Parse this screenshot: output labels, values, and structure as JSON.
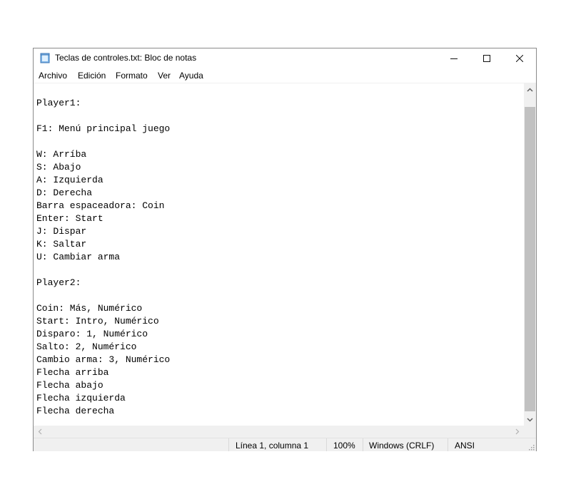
{
  "window": {
    "title": "Teclas de controles.txt: Bloc de notas",
    "icon": "notepad-icon"
  },
  "menu": [
    "Archivo",
    "Edición",
    "Formato",
    "Ver",
    "Ayuda"
  ],
  "editor": {
    "text": "Player1:\n\nF1: Menú principal juego\n\nW: Arríba\nS: Abajo\nA: Izquierda\nD: Derecha\nBarra espaceadora: Coin\nEnter: Start\nJ: Dispar\nK: Saltar\nU: Cambiar arma\n\nPlayer2:\n\nCoin: Más, Numérico\nStart: Intro, Numérico\nDisparo: 1, Numérico\nSalto: 2, Numérico\nCambio arma: 3, Numérico\nFlecha arriba\nFlecha abajo\nFlecha izquierda\nFlecha derecha"
  },
  "status": {
    "position": "Línea 1, columna 1",
    "zoom": "100%",
    "line_ending": "Windows (CRLF)",
    "encoding": "ANSI"
  }
}
